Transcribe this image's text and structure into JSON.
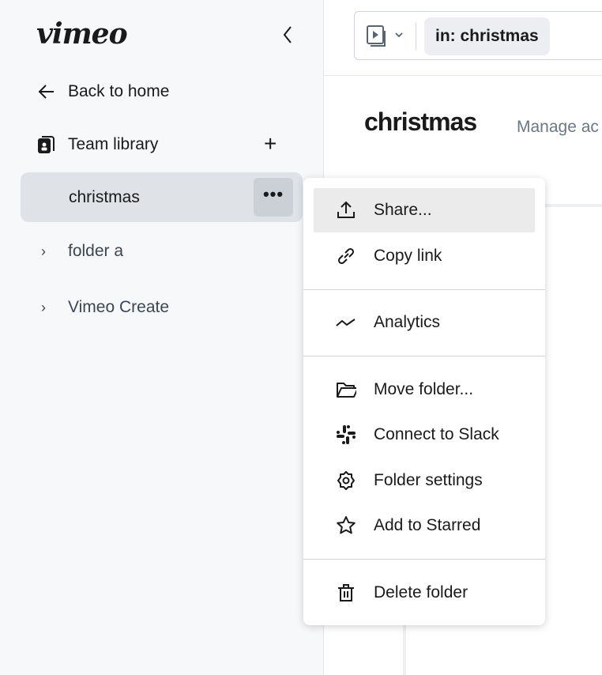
{
  "sidebar": {
    "logo": "vimeo",
    "back": "Back to home",
    "team_library": "Team library",
    "selected_folder": "christmas",
    "folders": [
      {
        "label": "folder a"
      },
      {
        "label": "Vimeo Create"
      }
    ]
  },
  "header": {
    "search_chip": "in: christmas"
  },
  "main": {
    "title": "christmas",
    "manage": "Manage ac"
  },
  "menu": {
    "items": [
      {
        "label": "Share...",
        "icon": "share-icon"
      },
      {
        "label": "Copy link",
        "icon": "link-icon"
      },
      {
        "label": "Analytics",
        "icon": "analytics-icon"
      },
      {
        "label": "Move folder...",
        "icon": "folder-open-icon"
      },
      {
        "label": "Connect to Slack",
        "icon": "slack-icon"
      },
      {
        "label": "Folder settings",
        "icon": "gear-icon"
      },
      {
        "label": "Add to Starred",
        "icon": "star-icon"
      },
      {
        "label": "Delete folder",
        "icon": "trash-icon"
      }
    ]
  }
}
